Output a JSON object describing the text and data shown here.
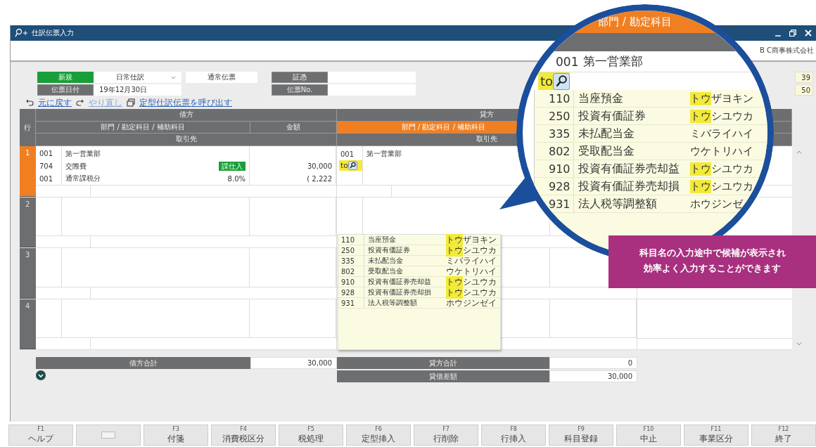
{
  "window": {
    "title": "仕訳伝票入力",
    "company": "B C商事株式会社"
  },
  "header_form": {
    "mode": "新規",
    "journal_type": "日常仕訳",
    "voucher_type": "通常伝票",
    "date_label": "伝票日付",
    "date": "19年12月30日",
    "evidence_label": "証憑",
    "voucher_no_label": "伝票No."
  },
  "side_counts": [
    "39",
    "50"
  ],
  "links": [
    {
      "kind": "undo",
      "label": "元に戻す",
      "disabled": false
    },
    {
      "kind": "redo",
      "label": "やり直し",
      "disabled": true
    },
    {
      "kind": "template",
      "label": "定型仕訳伝票を呼び出す",
      "disabled": false
    }
  ],
  "grid": {
    "row_header": "行",
    "debit": {
      "title": "借方",
      "account_header": "部門 / 勘定科目 / 補助科目",
      "amount_header": "金額",
      "partner_header": "取引先"
    },
    "credit": {
      "title": "貸方",
      "account_header": "部門 / 勘定科目 / 補助科目",
      "account_header_active": true,
      "partner_header": "取引先"
    },
    "rows": [
      {
        "number": "1",
        "selected": true,
        "debit": [
          {
            "code": "001",
            "name": "第一営業部"
          },
          {
            "code": "704",
            "name": "交際費",
            "tag": "課仕入",
            "amount": "30,000"
          },
          {
            "code": "001",
            "name": "通常課税分",
            "rate": "8.0%",
            "amount": "( 2,222"
          }
        ],
        "credit": [
          {
            "code": "001",
            "name": "第一営業部"
          }
        ],
        "credit_input": "to"
      },
      {
        "number": "2",
        "selected": false
      },
      {
        "number": "3",
        "selected": false
      },
      {
        "number": "4",
        "selected": false
      }
    ]
  },
  "suggestions": [
    {
      "code": "110",
      "name": "当座預金",
      "kana_parts": [
        {
          "text": "トウ",
          "highlighted": true
        },
        {
          "text": "ザヨキン",
          "highlighted": false
        }
      ]
    },
    {
      "code": "250",
      "name": "投資有価証券",
      "kana_parts": [
        {
          "text": "トウ",
          "highlighted": true
        },
        {
          "text": "シユウカ",
          "highlighted": false
        }
      ]
    },
    {
      "code": "335",
      "name": "未払配当金",
      "kana_parts": [
        {
          "text": "ミバライハイ",
          "highlighted": false
        }
      ]
    },
    {
      "code": "802",
      "name": "受取配当金",
      "kana_parts": [
        {
          "text": "ウケトリハイ",
          "highlighted": false
        }
      ]
    },
    {
      "code": "910",
      "name": "投資有価証券売却益",
      "kana_parts": [
        {
          "text": "トウ",
          "highlighted": true
        },
        {
          "text": "シユウカ",
          "highlighted": false
        }
      ]
    },
    {
      "code": "928",
      "name": "投資有価証券売却損",
      "kana_parts": [
        {
          "text": "トウ",
          "highlighted": true
        },
        {
          "text": "シユウカ",
          "highlighted": false
        }
      ]
    },
    {
      "code": "931",
      "name": "法人税等調整額",
      "kana_parts": [
        {
          "text": "ホウジンゼイ",
          "highlighted": false
        }
      ]
    }
  ],
  "totals": {
    "debit": {
      "label": "借方合計",
      "value": "30,000"
    },
    "credit": {
      "label": "貸方合計",
      "value": "0"
    },
    "difference": {
      "label": "貸借差額",
      "value": "30,000"
    }
  },
  "function_keys": [
    {
      "kind": "key",
      "key": "F1",
      "label": "ヘルプ"
    },
    {
      "kind": "blank"
    },
    {
      "kind": "key",
      "key": "F3",
      "label": "付箋"
    },
    {
      "kind": "key",
      "key": "F4",
      "label": "消費税区分"
    },
    {
      "kind": "key",
      "key": "F5",
      "label": "税処理"
    },
    {
      "kind": "key",
      "key": "F6",
      "label": "定型挿入"
    },
    {
      "kind": "key",
      "key": "F7",
      "label": "行削除"
    },
    {
      "kind": "key",
      "key": "F8",
      "label": "行挿入"
    },
    {
      "kind": "key",
      "key": "F9",
      "label": "科目登録"
    },
    {
      "kind": "key",
      "key": "F10",
      "label": "中止"
    },
    {
      "kind": "key",
      "key": "F11",
      "label": "事業区分"
    },
    {
      "kind": "key",
      "key": "F12",
      "label": "終了"
    }
  ],
  "magnifier": {
    "header": "部門 / 勘定科目",
    "row": {
      "code": "001",
      "name": "第一営業部"
    },
    "input": "to",
    "suggestions": [
      {
        "code": "110",
        "name": "当座預金",
        "kana_parts": [
          {
            "text": "トウ",
            "highlighted": true
          },
          {
            "text": "ザヨキン",
            "highlighted": false
          }
        ]
      },
      {
        "code": "250",
        "name": "投資有価証券",
        "kana_parts": [
          {
            "text": "トウ",
            "highlighted": true
          },
          {
            "text": "シユウカ",
            "highlighted": false
          }
        ]
      },
      {
        "code": "335",
        "name": "未払配当金",
        "kana_parts": [
          {
            "text": "ミバライハイ",
            "highlighted": false
          }
        ]
      },
      {
        "code": "802",
        "name": "受取配当金",
        "kana_parts": [
          {
            "text": "ウケトリハイ",
            "highlighted": false
          }
        ]
      },
      {
        "code": "910",
        "name": "投資有価証券売却益",
        "kana_parts": [
          {
            "text": "トウ",
            "highlighted": true
          },
          {
            "text": "シユウカ",
            "highlighted": false
          }
        ]
      },
      {
        "code": "928",
        "name": "投資有価証券売却損",
        "kana_parts": [
          {
            "text": "トウ",
            "highlighted": true
          },
          {
            "text": "シユウカ",
            "highlighted": false
          }
        ]
      },
      {
        "code": "931",
        "name": "法人税等調整額",
        "kana_parts": [
          {
            "text": "ホウジンゼ",
            "highlighted": false
          }
        ]
      }
    ]
  },
  "callout": {
    "text": "科目名の入力途中で候補が表示され効率よく入力することができます"
  }
}
